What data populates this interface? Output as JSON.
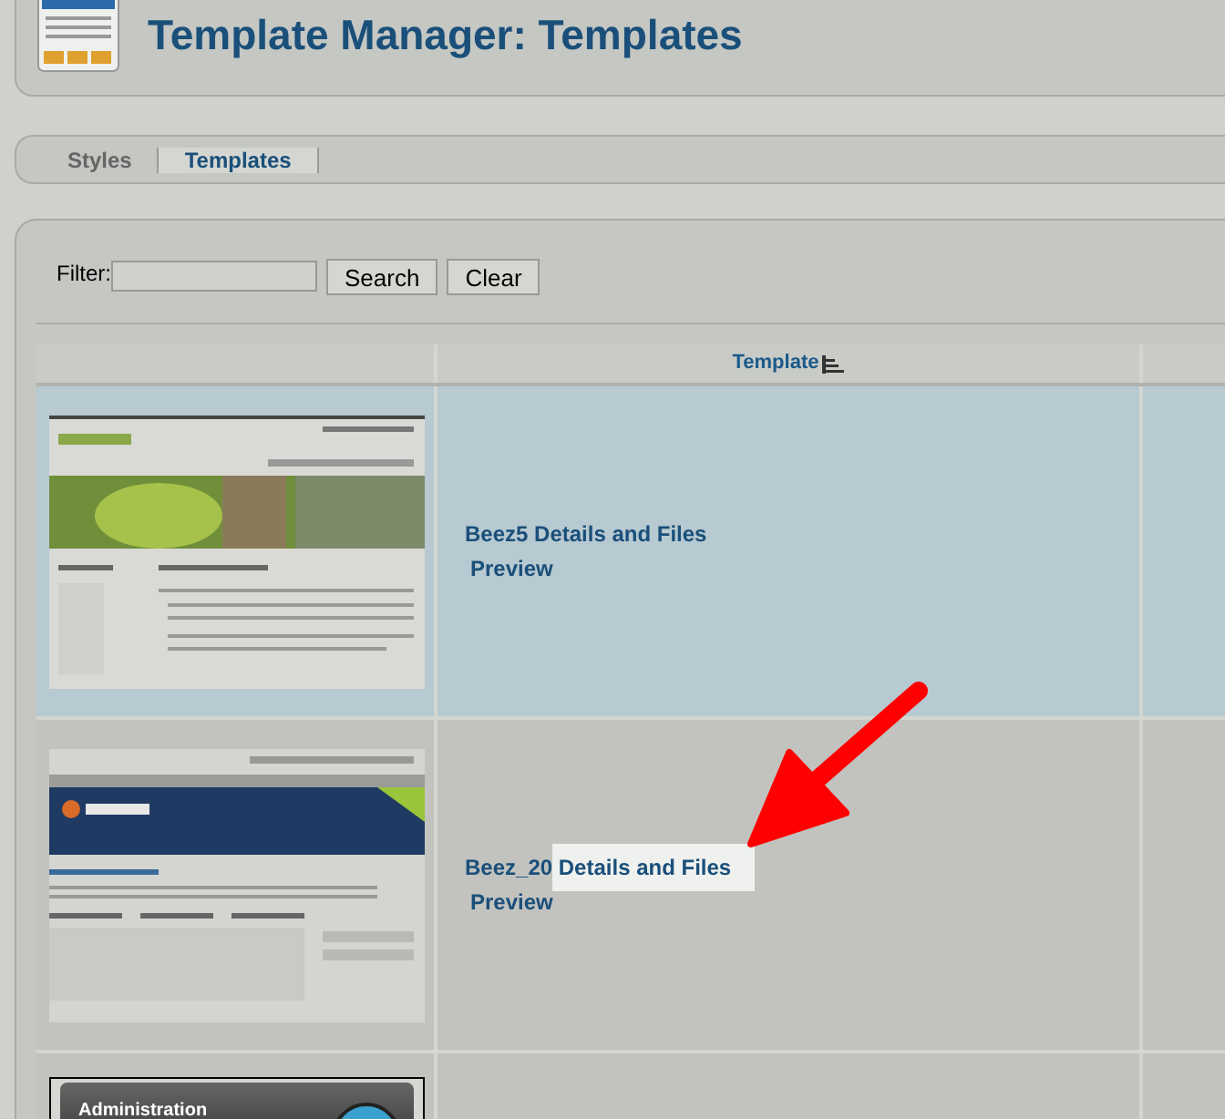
{
  "header": {
    "title": "Template Manager: Templates"
  },
  "tabs": [
    {
      "label": "Styles",
      "selected": false
    },
    {
      "label": "Templates",
      "selected": true
    }
  ],
  "filter": {
    "label": "Filter:",
    "buttons": [
      "Search",
      "Clear"
    ]
  },
  "table": {
    "columns": [
      "Template"
    ],
    "rows": [
      {
        "thumbnail": {
          "kind": "shop"
        },
        "name": "Beez5",
        "details": "Details and Files",
        "preview": "Preview",
        "selected": true,
        "highlighted": false
      },
      {
        "thumbnail": {
          "kind": "portal"
        },
        "name": "Beez_20",
        "details": "Details and Files",
        "preview": "Preview",
        "selected": false,
        "highlighted": true
      },
      {
        "thumbnail": {
          "kind": "admin",
          "title": "Administration"
        },
        "selected": false
      }
    ]
  }
}
